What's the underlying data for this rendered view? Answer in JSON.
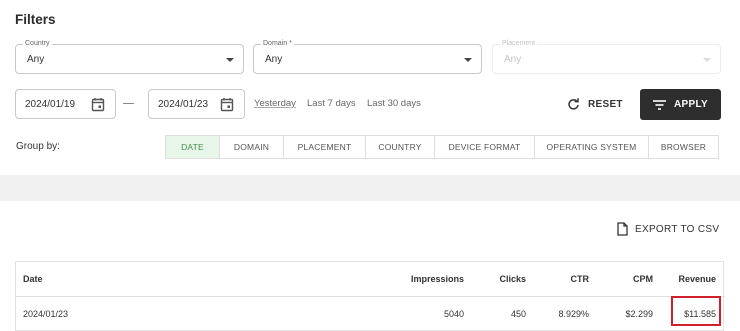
{
  "header": {
    "title": "Filters"
  },
  "filters": {
    "country": {
      "label": "Country",
      "value": "Any"
    },
    "domain": {
      "label": "Domain *",
      "value": "Any"
    },
    "placement": {
      "label": "Placement",
      "value": "Any",
      "disabled": true
    }
  },
  "dates": {
    "from": "2024/01/19",
    "to": "2024/01/23"
  },
  "quick_ranges": [
    "Yesterday",
    "Last 7 days",
    "Last 30 days"
  ],
  "actions": {
    "reset_label": "RESET",
    "apply_label": "APPLY",
    "export_label": "EXPORT TO CSV"
  },
  "group_by": {
    "label": "Group by:",
    "active": "DATE",
    "options": [
      "DATE",
      "DOMAIN",
      "PLACEMENT",
      "COUNTRY",
      "DEVICE FORMAT",
      "OPERATING SYSTEM",
      "BROWSER"
    ]
  },
  "table": {
    "columns": [
      "Date",
      "Impressions",
      "Clicks",
      "CTR",
      "CPM",
      "Revenue"
    ],
    "rows": [
      [
        "2024/01/23",
        "5040",
        "450",
        "8.929%",
        "$2.299",
        "$11.585"
      ]
    ]
  },
  "colors": {
    "accent_active": "#e8f5e9",
    "apply_bg": "#2e2e2e",
    "highlight": "#d0202a"
  },
  "icons": {
    "calendar": "calendar-icon",
    "reset": "refresh-icon",
    "apply": "filter-lines-icon",
    "export": "document-icon"
  }
}
